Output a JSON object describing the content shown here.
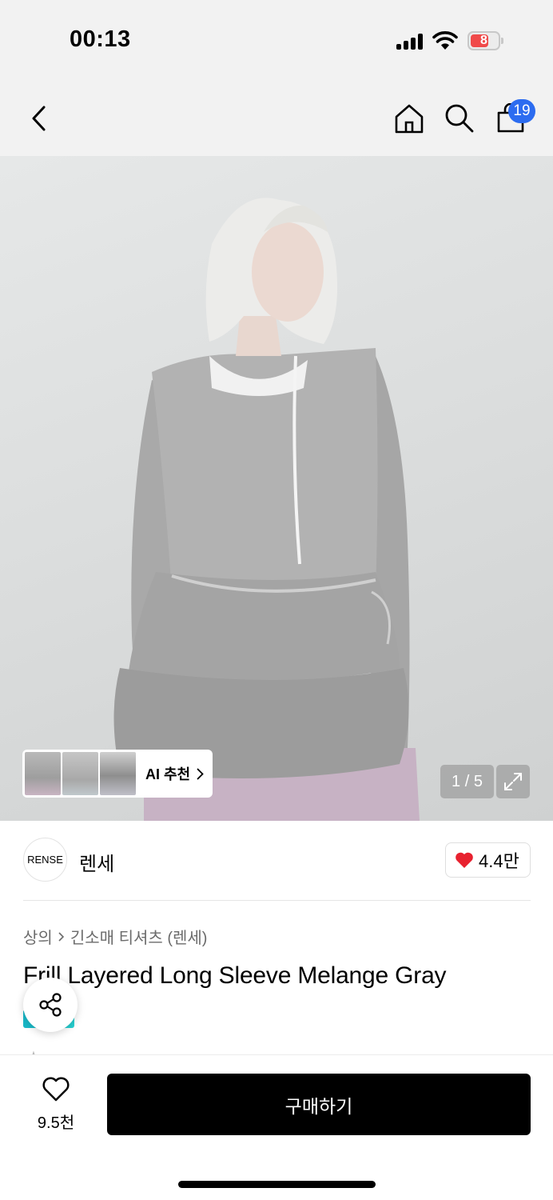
{
  "status_bar": {
    "time": "00:13",
    "battery_level": "8",
    "signal_icon": "cellular-signal-icon",
    "wifi_icon": "wifi-icon"
  },
  "header": {
    "back_icon": "chevron-left-icon",
    "home_icon": "home-icon",
    "search_icon": "search-icon",
    "cart_icon": "shopping-bag-icon",
    "cart_count": "19"
  },
  "gallery": {
    "ai_recommend_label": "AI 추천",
    "page_indicator": "1 / 5",
    "expand_icon": "expand-icon"
  },
  "brand": {
    "logo_text": "RENSE",
    "name": "렌세",
    "like_count": "4.4만",
    "like_color": "#e8212f"
  },
  "breadcrumb": {
    "items": [
      "상의",
      "긴소매 티셔츠 (렌세)"
    ]
  },
  "product": {
    "title": "Frill Layered Long Sleeve Melange Gray"
  },
  "bottom_bar": {
    "wishlist_count": "9.5천",
    "buy_label": "구매하기"
  },
  "colors": {
    "accent_badge": "#2c6cf0",
    "primary_button": "#000000"
  }
}
